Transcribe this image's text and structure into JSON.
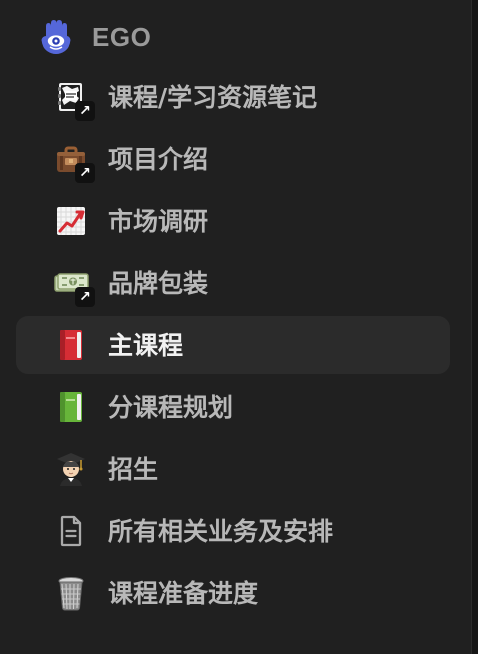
{
  "workspace": {
    "name": "EGO",
    "icon": "hamsa-eye-icon"
  },
  "nav": {
    "items": [
      {
        "label": "课程/学习资源笔记",
        "icon": "notebook-shortcut-icon",
        "shortcut": true,
        "active": false
      },
      {
        "label": "项目介绍",
        "icon": "briefcase-shortcut-icon",
        "shortcut": true,
        "active": false
      },
      {
        "label": "市场调研",
        "icon": "chart-increasing-icon",
        "shortcut": false,
        "active": false
      },
      {
        "label": "品牌包装",
        "icon": "money-shortcut-icon",
        "shortcut": true,
        "active": false
      },
      {
        "label": "主课程",
        "icon": "red-book-icon",
        "shortcut": false,
        "active": true
      },
      {
        "label": "分课程规划",
        "icon": "green-book-icon",
        "shortcut": false,
        "active": false
      },
      {
        "label": "招生",
        "icon": "student-icon",
        "shortcut": false,
        "active": false
      },
      {
        "label": "所有相关业务及安排",
        "icon": "document-icon",
        "shortcut": false,
        "active": false
      },
      {
        "label": "课程准备进度",
        "icon": "trash-can-icon",
        "shortcut": false,
        "active": false
      }
    ]
  },
  "colors": {
    "background": "#202020",
    "activeRow": "#2b2b2b",
    "text": "#b8b8b8",
    "activeText": "#f1f1f1",
    "workspaceIcon": "#5b6bd8"
  }
}
